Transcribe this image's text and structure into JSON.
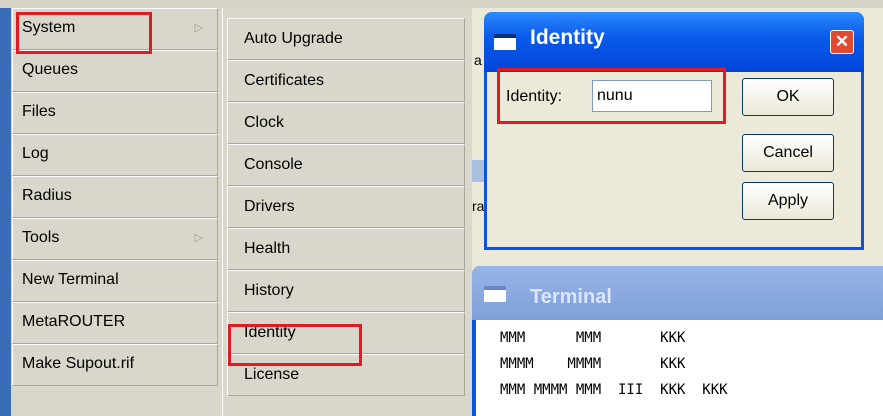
{
  "menu": {
    "items": [
      {
        "label": "System",
        "has_submenu": true
      },
      {
        "label": "Queues",
        "has_submenu": false
      },
      {
        "label": "Files",
        "has_submenu": false
      },
      {
        "label": "Log",
        "has_submenu": false
      },
      {
        "label": "Radius",
        "has_submenu": false
      },
      {
        "label": "Tools",
        "has_submenu": true
      },
      {
        "label": "New Terminal",
        "has_submenu": false
      },
      {
        "label": "MetaROUTER",
        "has_submenu": false
      },
      {
        "label": "Make Supout.rif",
        "has_submenu": false
      }
    ]
  },
  "submenu": {
    "items": [
      {
        "label": "Auto Upgrade"
      },
      {
        "label": "Certificates"
      },
      {
        "label": "Clock"
      },
      {
        "label": "Console"
      },
      {
        "label": "Drivers"
      },
      {
        "label": "Health"
      },
      {
        "label": "History"
      },
      {
        "label": "Identity"
      },
      {
        "label": "License"
      }
    ]
  },
  "background_window": {
    "fragment_1": "a",
    "fragment_2": "ra"
  },
  "identity_dialog": {
    "title": "Identity",
    "field_label": "Identity:",
    "field_value": "nunu",
    "buttons": {
      "ok": "OK",
      "cancel": "Cancel",
      "apply": "Apply"
    }
  },
  "terminal": {
    "title": "Terminal",
    "lines": [
      "MMM      MMM       KKK",
      "MMMM    MMMM       KKK",
      "MMM MMMM MMM  III  KKK  KKK"
    ]
  },
  "colors": {
    "highlight": "#e01b24",
    "titlebar_active": "#0a54e0",
    "titlebar_inactive": "#7e9fda",
    "menu_bg": "#d9d6cb"
  }
}
